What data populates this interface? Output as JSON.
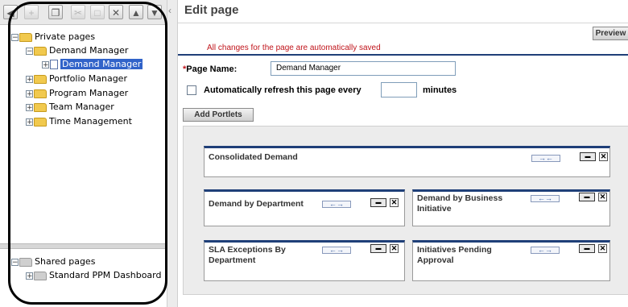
{
  "tree": {
    "private_root": "Private pages",
    "demand_manager_folder": "Demand Manager",
    "demand_manager_page": "Demand Manager",
    "portfolio_manager": "Portfolio Manager",
    "program_manager": "Program Manager",
    "team_manager": "Team Manager",
    "time_management": "Time Management",
    "shared_root": "Shared pages",
    "standard_dashboard": "Standard PPM Dashboard"
  },
  "header": {
    "title": "Edit page",
    "preview_label": "Preview",
    "autosave_notice": "All changes for the page are automatically saved"
  },
  "form": {
    "page_name_required": "*",
    "page_name_label": "Page Name:",
    "page_name_value": "Demand Manager",
    "auto_refresh_label": "Automatically refresh this page every",
    "auto_refresh_value": "",
    "minutes_label": "minutes",
    "add_portlets_label": "Add Portlets"
  },
  "portlets": {
    "consolidated": "Consolidated Demand",
    "by_department": "Demand by Department",
    "by_business": "Demand by Business Initiative",
    "sla_exceptions": "SLA Exceptions By Department",
    "initiatives_pending": "Initiatives Pending Approval"
  },
  "colors": {
    "selection": "#3163c9",
    "notice": "#c0141b",
    "portlet_border": "#1f3f78",
    "folder": "#f1c94e"
  }
}
